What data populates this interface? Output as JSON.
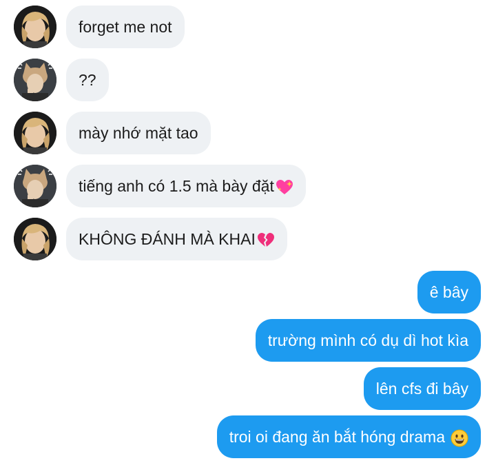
{
  "messages_in": [
    {
      "text": "forget me not",
      "avatar": "blonde-avatar"
    },
    {
      "text": "??",
      "avatar": "cat-ear-avatar"
    },
    {
      "text": "mày nhớ mặt tao",
      "avatar": "blonde-avatar"
    },
    {
      "text": "tiếng anh có 1.5 mà bày đặt",
      "emoji": "sparkling-heart-icon",
      "avatar": "cat-ear-avatar"
    },
    {
      "text": "KHÔNG ĐÁNH MÀ KHAI",
      "emoji": "broken-heart-icon",
      "avatar": "blonde-avatar"
    }
  ],
  "messages_out": [
    {
      "text": "ê bây"
    },
    {
      "text": "trường mình có dụ dì hot kìa"
    },
    {
      "text": "lên cfs đi bây"
    },
    {
      "text": "troi oi đang ăn bắt hóng drama",
      "emoji": "grinning-face-icon"
    }
  ],
  "colors": {
    "incoming_bubble": "#eef1f4",
    "outgoing_bubble": "#1d9bf0",
    "incoming_text": "#1c1c1c",
    "outgoing_text": "#ffffff"
  }
}
